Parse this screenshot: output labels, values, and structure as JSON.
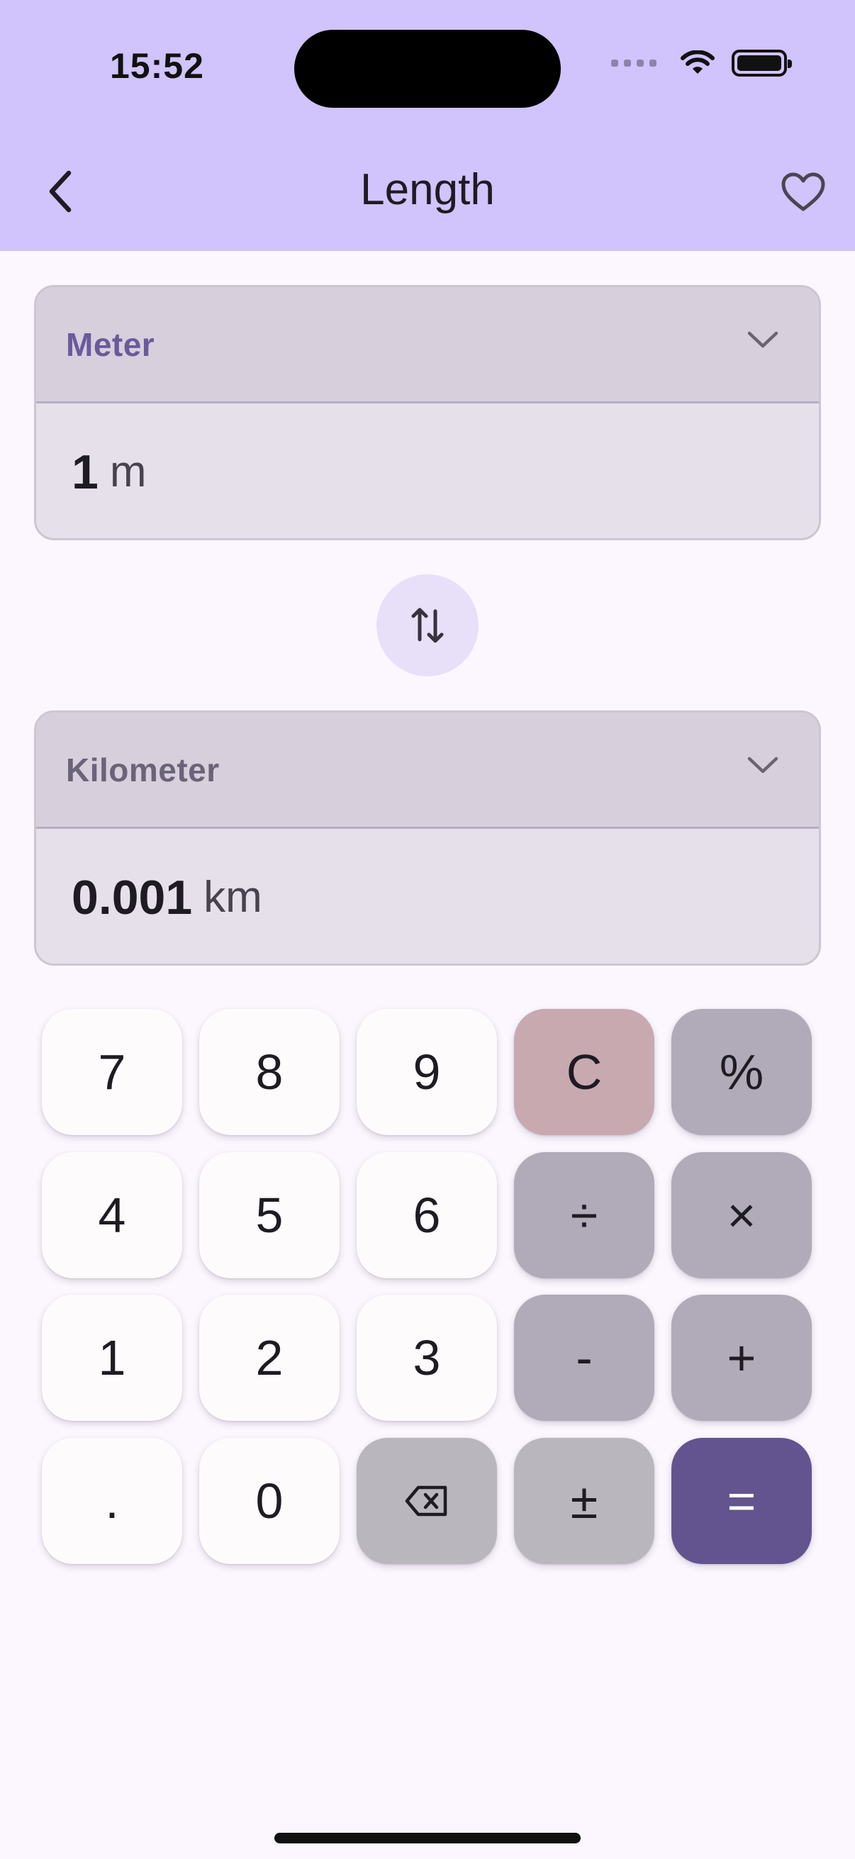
{
  "status_bar": {
    "time": "15:52"
  },
  "header": {
    "title": "Length"
  },
  "from": {
    "unit_name": "Meter",
    "value": "1",
    "symbol": "m"
  },
  "to": {
    "unit_name": "Kilometer",
    "value": "0.001",
    "symbol": "km"
  },
  "keypad": {
    "rows": [
      [
        "7",
        "8",
        "9",
        "C",
        "%"
      ],
      [
        "4",
        "5",
        "6",
        "÷",
        "×"
      ],
      [
        "1",
        "2",
        "3",
        "-",
        "+"
      ],
      [
        ".",
        "0",
        "",
        "±",
        "="
      ]
    ]
  },
  "colors": {
    "header_bg": "#d1c3fb",
    "page_bg": "#fcf7fe",
    "from_unit_label": "#6a5a9c",
    "to_unit_label": "#6b6478",
    "equals_key": "#63548f",
    "clear_key": "#c8a9b0"
  },
  "icons": {
    "back": "chevron-left-icon",
    "favorite": "heart-outline-icon",
    "swap": "swap-vertical-icon",
    "dropdown": "chevron-down-icon",
    "backspace": "backspace-icon"
  }
}
